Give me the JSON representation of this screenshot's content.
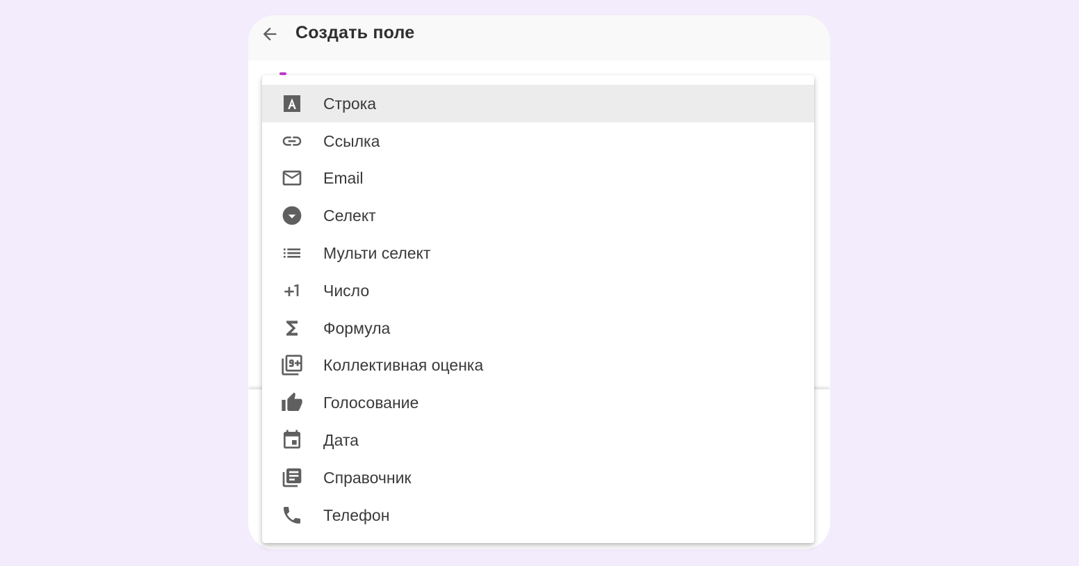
{
  "dialog": {
    "title": "Создать поле"
  },
  "menu": {
    "selected_index": 0,
    "items": [
      {
        "label": "Строка",
        "icon": "text-a-icon"
      },
      {
        "label": "Ссылка",
        "icon": "link-icon"
      },
      {
        "label": "Email",
        "icon": "mail-icon"
      },
      {
        "label": "Селект",
        "icon": "dropdown-circle-icon"
      },
      {
        "label": "Мульти селект",
        "icon": "list-icon"
      },
      {
        "label": "Число",
        "icon": "plus-one-icon"
      },
      {
        "label": "Формула",
        "icon": "sigma-icon"
      },
      {
        "label": "Коллективная оценка",
        "icon": "filter-9-plus-icon"
      },
      {
        "label": "Голосование",
        "icon": "thumb-up-icon"
      },
      {
        "label": "Дата",
        "icon": "calendar-icon"
      },
      {
        "label": "Справочник",
        "icon": "library-books-icon"
      },
      {
        "label": "Телефон",
        "icon": "phone-icon"
      }
    ]
  },
  "colors": {
    "background": "#f3ecfc",
    "selected_row": "#ececec",
    "icon": "#5f5f5f",
    "accent": "#c33bd1"
  }
}
